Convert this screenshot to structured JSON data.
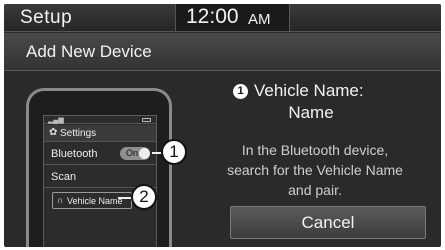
{
  "status_bar": {
    "title": "Setup",
    "time": "12:00",
    "ampm": "AM"
  },
  "header": {
    "title": "Add New Device"
  },
  "phone": {
    "settings_label": "Settings",
    "bluetooth_label": "Bluetooth",
    "toggle_state": "On",
    "scan_label": "Scan",
    "vehicle_item_label": "Vehicle Name"
  },
  "callouts": [
    "1",
    "2"
  ],
  "vehicle_name": {
    "badge": "1",
    "label": "Vehicle Name:",
    "value": "Name"
  },
  "instruction_lines": [
    "In the Bluetooth device,",
    "search for the Vehicle Name",
    "and pair."
  ],
  "cancel_label": "Cancel"
}
